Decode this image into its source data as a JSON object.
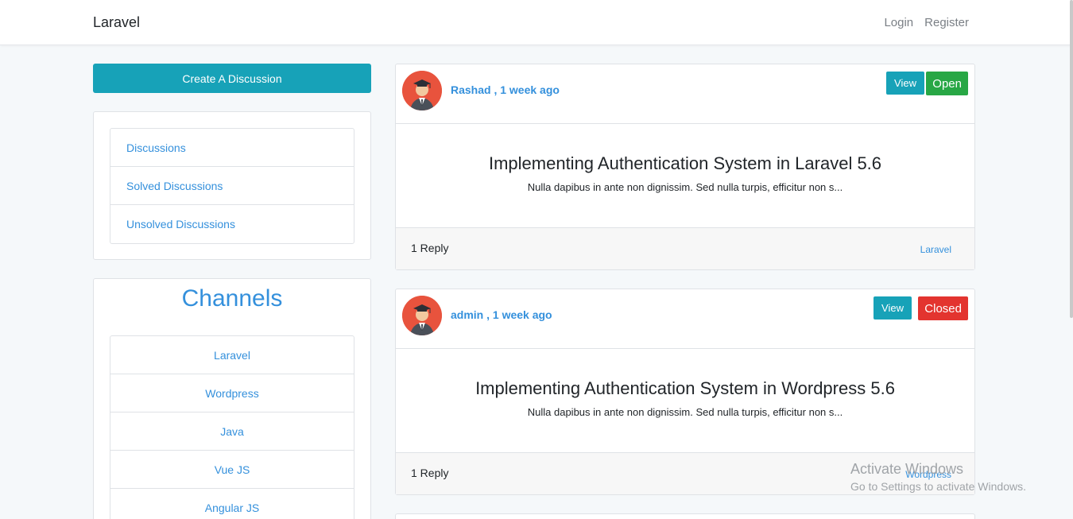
{
  "navbar": {
    "brand": "Laravel",
    "login": "Login",
    "register": "Register"
  },
  "sidebar": {
    "create_button": "Create A Discussion",
    "nav_items": [
      "Discussions",
      "Solved Discussions",
      "Unsolved Discussions"
    ],
    "channels_title": "Channels",
    "channels": [
      "Laravel",
      "Wordpress",
      "Java",
      "Vue JS",
      "Angular JS"
    ]
  },
  "discussions": [
    {
      "author": "Rashad , 1 week ago",
      "view_label": "View",
      "status_label": "Open",
      "status_color": "#28a745",
      "title": "Implementing Authentication System in Laravel 5.6",
      "excerpt": "Nulla dapibus in ante non dignissim. Sed nulla turpis, efficitur non s...",
      "replies": "1 Reply",
      "channel": "Laravel"
    },
    {
      "author": "admin , 1 week ago",
      "view_label": "View",
      "status_label": "Closed",
      "status_color": "#e3342f",
      "title": "Implementing Authentication System in Wordpress 5.6",
      "excerpt": "Nulla dapibus in ante non dignissim. Sed nulla turpis, efficitur non s...",
      "replies": "1 Reply",
      "channel": "Wordpress"
    }
  ],
  "watermark": {
    "line1": "Activate Windows",
    "line2": "Go to Settings to activate Windows."
  }
}
